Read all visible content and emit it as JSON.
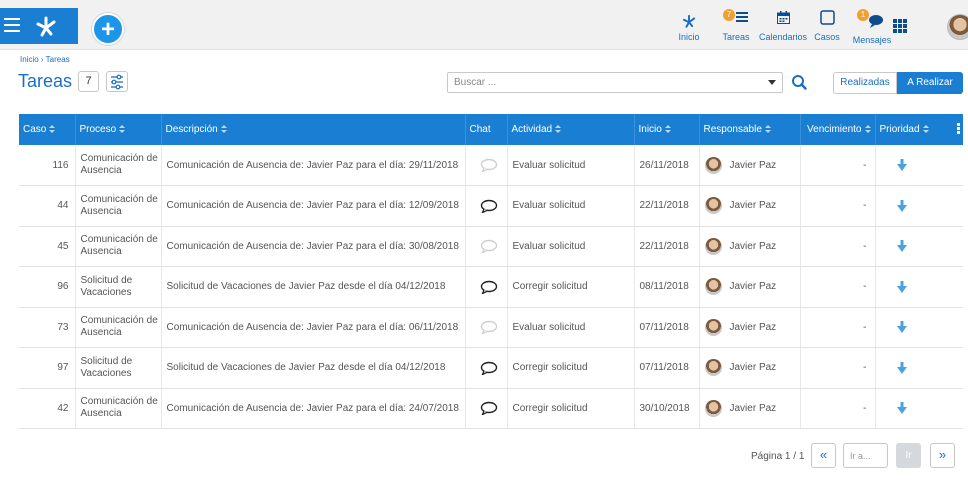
{
  "header": {
    "nav": [
      {
        "id": "inicio",
        "label": "Inicio",
        "icon": "branch-logo-icon",
        "badge": null
      },
      {
        "id": "tareas",
        "label": "Tareas",
        "icon": "tasks-list-icon",
        "badge": "7"
      },
      {
        "id": "calendarios",
        "label": "Calendarios",
        "icon": "calendar-icon",
        "badge": null
      },
      {
        "id": "casos",
        "label": "Casos",
        "icon": "case-square-icon",
        "badge": null
      },
      {
        "id": "mensajes",
        "label": "Mensajes",
        "icon": "chat-bubbles-icon",
        "badge": "1"
      }
    ]
  },
  "breadcrumb": "Inicio › Tareas",
  "page": {
    "title": "Tareas",
    "count": "7"
  },
  "search": {
    "placeholder": "Buscar ..."
  },
  "toggle": {
    "done_label": "Realizadas",
    "todo_label": "A Realizar"
  },
  "table": {
    "columns": [
      "Caso",
      "Proceso",
      "Descripción",
      "Chat",
      "Actividad",
      "Inicio",
      "Responsable",
      "Vencimiento",
      "Prioridad"
    ],
    "rows": [
      {
        "caso": "116",
        "proceso": "Comunicación de Ausencia",
        "descripcion": "Comunicación de Ausencia de: Javier Paz para el día: 29/11/2018",
        "chat_active": false,
        "actividad": "Evaluar solicitud",
        "inicio": "26/11/2018",
        "responsable": "Javier Paz",
        "vencimiento": "-"
      },
      {
        "caso": "44",
        "proceso": "Comunicación de Ausencia",
        "descripcion": "Comunicación de Ausencia de: Javier Paz para el día: 12/09/2018",
        "chat_active": true,
        "actividad": "Evaluar solicitud",
        "inicio": "22/11/2018",
        "responsable": "Javier Paz",
        "vencimiento": "-"
      },
      {
        "caso": "45",
        "proceso": "Comunicación de Ausencia",
        "descripcion": "Comunicación de Ausencia de: Javier Paz para el día: 30/08/2018",
        "chat_active": false,
        "actividad": "Evaluar solicitud",
        "inicio": "22/11/2018",
        "responsable": "Javier Paz",
        "vencimiento": "-"
      },
      {
        "caso": "96",
        "proceso": "Solicitud de Vacaciones",
        "descripcion": "Solicitud de Vacaciones de Javier Paz desde el día 04/12/2018",
        "chat_active": true,
        "actividad": "Corregir solicitud",
        "inicio": "08/11/2018",
        "responsable": "Javier Paz",
        "vencimiento": "-"
      },
      {
        "caso": "73",
        "proceso": "Comunicación de Ausencia",
        "descripcion": "Comunicación de Ausencia de: Javier Paz para el día: 06/11/2018",
        "chat_active": false,
        "actividad": "Evaluar solicitud",
        "inicio": "07/11/2018",
        "responsable": "Javier Paz",
        "vencimiento": "-"
      },
      {
        "caso": "97",
        "proceso": "Solicitud de Vacaciones",
        "descripcion": "Solicitud de Vacaciones de Javier Paz desde el día 04/12/2018",
        "chat_active": true,
        "actividad": "Corregir solicitud",
        "inicio": "07/11/2018",
        "responsable": "Javier Paz",
        "vencimiento": "-"
      },
      {
        "caso": "42",
        "proceso": "Comunicación de Ausencia",
        "descripcion": "Comunicación de Ausencia de: Javier Paz para el día: 24/07/2018",
        "chat_active": true,
        "actividad": "Corregir solicitud",
        "inicio": "30/10/2018",
        "responsable": "Javier Paz",
        "vencimiento": "-"
      }
    ]
  },
  "pager": {
    "info": "Página 1 / 1",
    "first": "«",
    "goto_placeholder": "Ir a...",
    "go": "Ir",
    "last": "»"
  },
  "colors": {
    "primary": "#1a7fd3",
    "accent": "#1e96e8",
    "badge": "#f0a030",
    "priority_arrow": "#4aa3df"
  }
}
